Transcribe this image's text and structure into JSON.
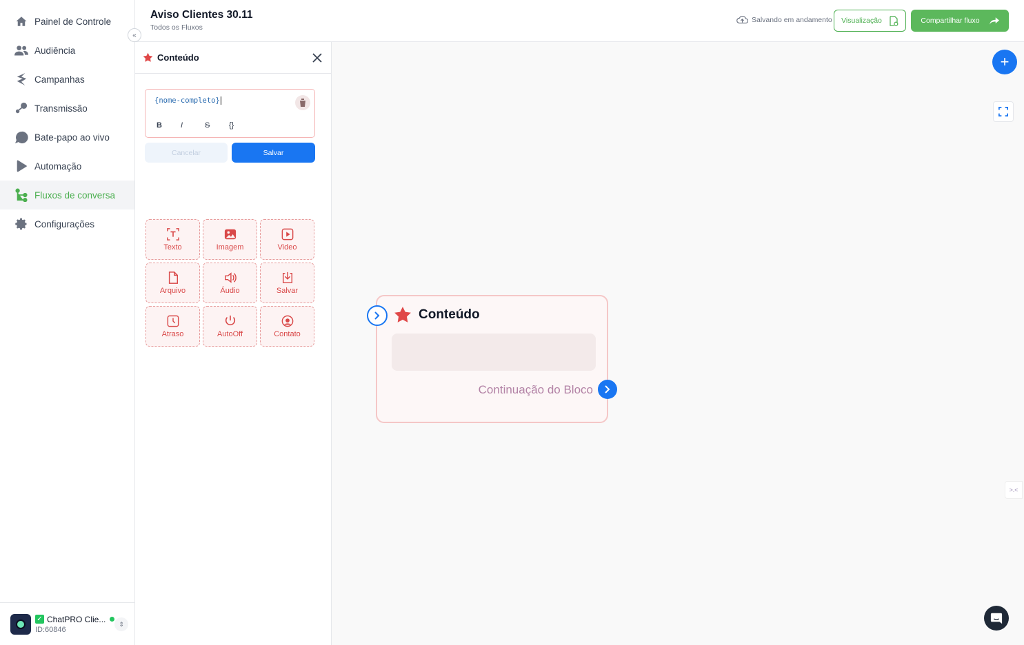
{
  "sidebar": {
    "items": [
      {
        "label": "Painel de Controle",
        "icon": "home-icon"
      },
      {
        "label": "Audiência",
        "icon": "users-icon"
      },
      {
        "label": "Campanhas",
        "icon": "campaign-icon"
      },
      {
        "label": "Transmissão",
        "icon": "broadcast-icon"
      },
      {
        "label": "Bate-papo ao vivo",
        "icon": "chat-icon"
      },
      {
        "label": "Automação",
        "icon": "play-icon"
      },
      {
        "label": "Fluxos de conversa",
        "icon": "flow-icon",
        "active": true
      },
      {
        "label": "Configurações",
        "icon": "gear-icon"
      }
    ],
    "account": {
      "name": "ChatPRO Clie...",
      "id": "ID:60846",
      "status": "online"
    }
  },
  "header": {
    "title": "Aviso Clientes 30.11",
    "subtitle": "Todos os Fluxos",
    "saving_status": "Salvando em andamento",
    "preview_label": "Visualização",
    "share_label": "Compartilhar fluxo"
  },
  "panel": {
    "title": "Conteúdo",
    "editor_value": "{nome-completo}",
    "format_buttons": [
      "B",
      "I",
      "S",
      "{}"
    ],
    "cancel_label": "Cancelar",
    "save_label": "Salvar",
    "tiles": [
      {
        "label": "Texto",
        "icon": "text-icon"
      },
      {
        "label": "Imagem",
        "icon": "image-icon"
      },
      {
        "label": "Video",
        "icon": "video-icon"
      },
      {
        "label": "Arquivo",
        "icon": "file-icon"
      },
      {
        "label": "Áudio",
        "icon": "audio-icon"
      },
      {
        "label": "Salvar",
        "icon": "download-icon"
      },
      {
        "label": "Atraso",
        "icon": "clock-icon"
      },
      {
        "label": "AutoOff",
        "icon": "power-icon"
      },
      {
        "label": "Contato",
        "icon": "contact-icon"
      }
    ]
  },
  "canvas": {
    "node": {
      "title": "Conteúdo",
      "continuation_label": "Continuação do Bloco"
    }
  },
  "colors": {
    "accent_green": "#4caf50",
    "primary_blue": "#1976f2",
    "node_red": "#d94848"
  }
}
